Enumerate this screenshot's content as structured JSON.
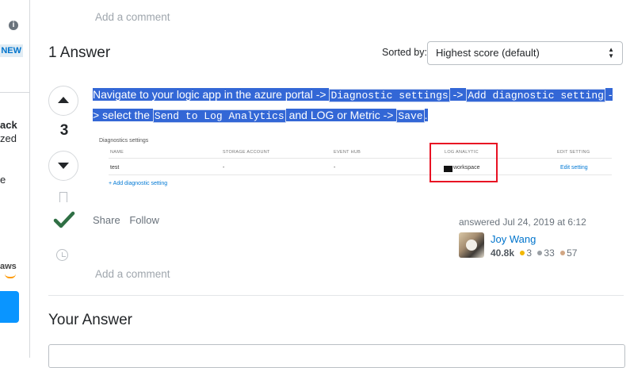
{
  "sidebar": {
    "new_badge": "NEW",
    "text_1": "ack",
    "text_2": "zed",
    "text_3": "e",
    "aws_label": "aws"
  },
  "question": {
    "add_comment": "Add a comment"
  },
  "answers_header": {
    "title": "1 Answer",
    "sorted_label": "Sorted by:",
    "sort_selected": "Highest score (default)"
  },
  "answer": {
    "vote_count": "3",
    "accepted": true,
    "segments": [
      {
        "type": "text",
        "text": "Navigate to your logic app in the azure portal -> "
      },
      {
        "type": "code",
        "text": "Diagnostic settings"
      },
      {
        "type": "text",
        "text": " -> "
      },
      {
        "type": "code",
        "text": "Add diagnostic setting"
      },
      {
        "type": "text",
        "text": " -> select the "
      },
      {
        "type": "code",
        "text": "Send to Log Analytics"
      },
      {
        "type": "text",
        "text": " and LOG or Metric -> "
      },
      {
        "type": "code",
        "text": "Save"
      },
      {
        "type": "text",
        "text": "."
      }
    ],
    "screenshot": {
      "title": "Diagnostics settings",
      "headers": [
        "NAME",
        "STORAGE ACCOUNT",
        "EVENT HUB",
        "LOG ANALYTIC",
        "EDIT SETTING"
      ],
      "row": [
        "test",
        "-",
        "-",
        "workspace",
        "Edit setting"
      ],
      "add_link": "+ Add diagnostic setting"
    },
    "share_label": "Share",
    "follow_label": "Follow",
    "answered": "answered Jul 24, 2019 at 6:12",
    "user": {
      "name": "Joy Wang",
      "reputation": "40.8k",
      "gold": "3",
      "silver": "33",
      "bronze": "57"
    },
    "add_comment": "Add a comment"
  },
  "your_answer": {
    "title": "Your Answer"
  },
  "colors": {
    "accent": "#0074cc",
    "selection": "#3367d6",
    "accepted": "#2f6f44",
    "gold": "#f1b600",
    "silver": "#9a9fa4",
    "bronze": "#d1a684",
    "highlight_box": "#e81123"
  }
}
